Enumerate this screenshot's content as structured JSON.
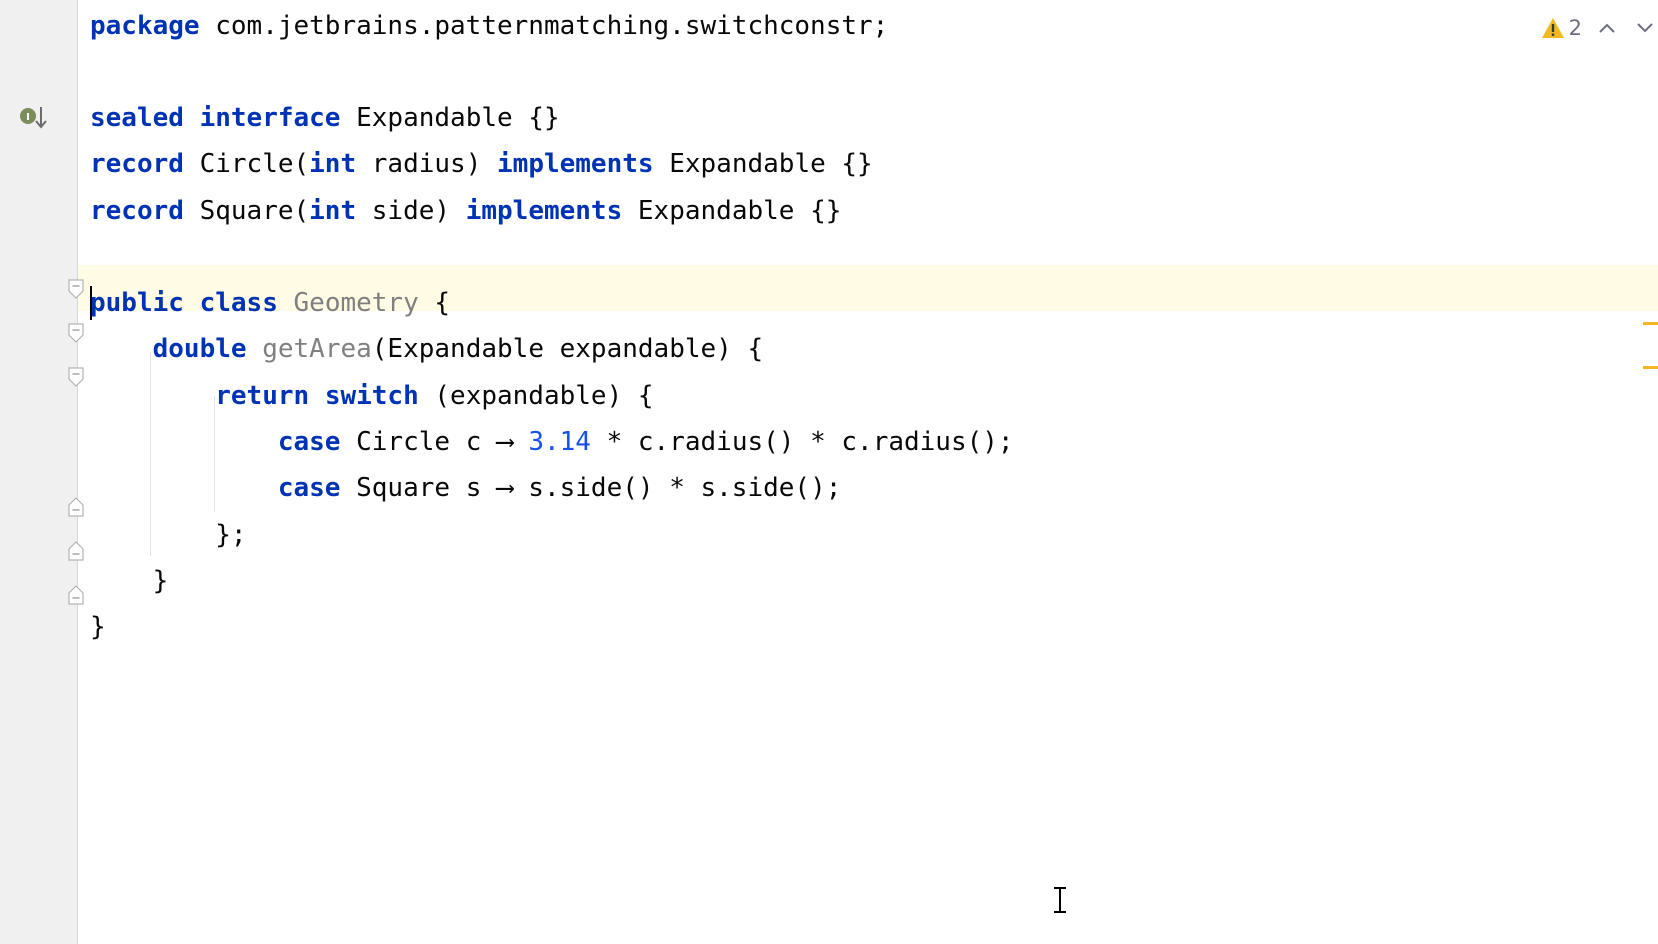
{
  "editor": {
    "inspections": {
      "warning_count": "2",
      "icon": "warning-triangle-icon",
      "prev_icon": "chevron-up-icon",
      "next_icon": "chevron-down-icon"
    },
    "gutter_icons": {
      "implemented": "implemented-interface-icon",
      "fold": "fold-icon"
    },
    "colors": {
      "keyword": "#0033b3",
      "number": "#1750eb",
      "unused": "#808080",
      "text": "#080808",
      "current_line": "#fffbe4",
      "gutter": "#f0f0f0",
      "warning": "#f2b824"
    },
    "lines": {
      "l1": [
        {
          "t": "package",
          "c": "kw"
        },
        {
          "t": " com.jetbrains.patternmatching.switchconstr;",
          "c": "plain"
        }
      ],
      "l2": [],
      "l3": [
        {
          "t": "sealed",
          "c": "kw"
        },
        {
          "t": " ",
          "c": "plain"
        },
        {
          "t": "interface",
          "c": "kw"
        },
        {
          "t": " Expandable {}",
          "c": "plain"
        }
      ],
      "l4": [
        {
          "t": "record",
          "c": "kw"
        },
        {
          "t": " Circle(",
          "c": "plain"
        },
        {
          "t": "int",
          "c": "kw"
        },
        {
          "t": " radius) ",
          "c": "plain"
        },
        {
          "t": "implements",
          "c": "kw"
        },
        {
          "t": " Expandable {}",
          "c": "plain"
        }
      ],
      "l5": [
        {
          "t": "record",
          "c": "kw"
        },
        {
          "t": " Square(",
          "c": "plain"
        },
        {
          "t": "int",
          "c": "kw"
        },
        {
          "t": " side) ",
          "c": "plain"
        },
        {
          "t": "implements",
          "c": "kw"
        },
        {
          "t": " Expandable {}",
          "c": "plain"
        }
      ],
      "l6": [],
      "l7": [
        {
          "t": "public",
          "c": "kw"
        },
        {
          "t": " ",
          "c": "plain"
        },
        {
          "t": "class",
          "c": "kw"
        },
        {
          "t": " ",
          "c": "plain"
        },
        {
          "t": "Geometry",
          "c": "unused"
        },
        {
          "t": " {",
          "c": "plain"
        }
      ],
      "l8": [
        {
          "t": "    ",
          "c": "plain"
        },
        {
          "t": "double",
          "c": "kw"
        },
        {
          "t": " ",
          "c": "plain"
        },
        {
          "t": "getArea",
          "c": "unused"
        },
        {
          "t": "(Expandable expandable) {",
          "c": "plain"
        }
      ],
      "l9": [
        {
          "t": "        ",
          "c": "plain"
        },
        {
          "t": "return",
          "c": "kw"
        },
        {
          "t": " ",
          "c": "plain"
        },
        {
          "t": "switch",
          "c": "kw"
        },
        {
          "t": " (expandable) {",
          "c": "plain"
        }
      ],
      "l10": [
        {
          "t": "            ",
          "c": "plain"
        },
        {
          "t": "case",
          "c": "kw"
        },
        {
          "t": " Circle c ⟶ ",
          "c": "plain"
        },
        {
          "t": "3.14",
          "c": "num"
        },
        {
          "t": " * c.radius() * c.radius();",
          "c": "plain"
        }
      ],
      "l11": [
        {
          "t": "            ",
          "c": "plain"
        },
        {
          "t": "case",
          "c": "kw"
        },
        {
          "t": " Square s ⟶ s.side() * s.side();",
          "c": "plain"
        }
      ],
      "l12": [
        {
          "t": "        };",
          "c": "plain"
        }
      ],
      "l13": [
        {
          "t": "    }",
          "c": "plain"
        }
      ],
      "l14": [
        {
          "t": "}",
          "c": "plain"
        }
      ]
    }
  }
}
